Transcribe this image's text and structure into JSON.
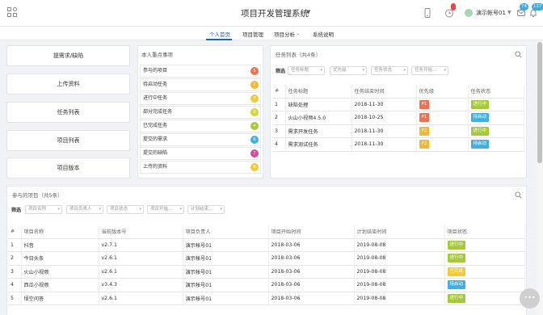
{
  "header": {
    "title": "项目开发管理系统",
    "user_name": "演示帐号01",
    "badge_count_1": "74",
    "badge_count_2": "127"
  },
  "nav": {
    "tabs": [
      "个人首页",
      "项目管理",
      "项目分析",
      "系统说明"
    ],
    "active": "个人首页"
  },
  "quick_actions": [
    "提需求/缺陷",
    "上传资料",
    "任务列表",
    "项目列表",
    "项目版本"
  ],
  "focus": {
    "title": "本人重点事项",
    "items": [
      {
        "label": "参与的项目",
        "count": "5",
        "color": "#f0704f"
      },
      {
        "label": "待启动任务",
        "count": "2",
        "color": "#f5b730"
      },
      {
        "label": "进行中任务",
        "count": "2",
        "color": "#f5c836"
      },
      {
        "label": "部分完成任务",
        "count": "0",
        "color": "#d6d637"
      },
      {
        "label": "已完成任务",
        "count": "4",
        "color": "#a6c83b"
      },
      {
        "label": "提交的需求",
        "count": "6",
        "color": "#3fb0e4"
      },
      {
        "label": "提交的缺陷",
        "count": "7",
        "color": "#d9489a"
      },
      {
        "label": "上传的资料",
        "count": "6",
        "color": "#f5c836"
      }
    ]
  },
  "task_list": {
    "title": "任务列表（共4条）",
    "filter_label": "筛选",
    "filters": [
      "任务标题",
      "优先级",
      "任务状态",
      "任务开始..."
    ],
    "columns": [
      "#",
      "任务标题",
      "任务结束时间",
      "优先级",
      "任务状态"
    ],
    "rows": [
      {
        "no": "1",
        "title": "缺陷处理",
        "end": "2018-11-30",
        "priority": "P1",
        "pcolor": "#f0704f",
        "status": "进行中",
        "scolor": "#a6c83b"
      },
      {
        "no": "2",
        "title": "火山小视频4.5.0",
        "end": "2018-10-25",
        "priority": "P1",
        "pcolor": "#f0704f",
        "status": "待启动",
        "scolor": "#3fb0e4"
      },
      {
        "no": "3",
        "title": "需求开发任务",
        "end": "2018-11-30",
        "priority": "P2",
        "pcolor": "#f5b730",
        "status": "进行中",
        "scolor": "#a6c83b"
      },
      {
        "no": "4",
        "title": "需求测试任务",
        "end": "2018-11-30",
        "priority": "P2",
        "pcolor": "#f5b730",
        "status": "待启动",
        "scolor": "#3fb0e4"
      }
    ]
  },
  "project_list": {
    "title": "参与的项目（共5条）",
    "filter_label": "筛选",
    "filters": [
      "项目名称",
      "项目负责人",
      "项目状态",
      "项目开始...",
      "计划结束..."
    ],
    "columns": [
      "#",
      "项目名称",
      "当前版本号",
      "项目负责人",
      "项目开始时间",
      "计划结束时间",
      "项目状态"
    ],
    "rows": [
      {
        "no": "1",
        "name": "抖音",
        "version": "v2.7.1",
        "owner": "演示帐号01",
        "start": "2018-03-06",
        "end": "2019-08-08",
        "status": "进行中",
        "scolor": "#a6c83b"
      },
      {
        "no": "2",
        "name": "今日头条",
        "version": "v2.6.1",
        "owner": "演示帐号01",
        "start": "2018-03-06",
        "end": "2019-08-08",
        "status": "进行中",
        "scolor": "#a6c83b"
      },
      {
        "no": "3",
        "name": "火山小视频",
        "version": "v2.6.1",
        "owner": "演示帐号01",
        "start": "2018-03-06",
        "end": "2019-08-08",
        "status": "已完成",
        "scolor": "#f5c836"
      },
      {
        "no": "4",
        "name": "西瓜小视频",
        "version": "v3.4.3",
        "owner": "演示帐号01",
        "start": "2018-03-06",
        "end": "2019-08-08",
        "status": "待启动",
        "scolor": "#3fb0e4"
      },
      {
        "no": "5",
        "name": "悟空问答",
        "version": "v2.6.1",
        "owner": "演示帐号01",
        "start": "2018-03-06",
        "end": "2019-08-08",
        "status": "进行中",
        "scolor": "#a6c83b"
      }
    ]
  },
  "float_button": "•••"
}
